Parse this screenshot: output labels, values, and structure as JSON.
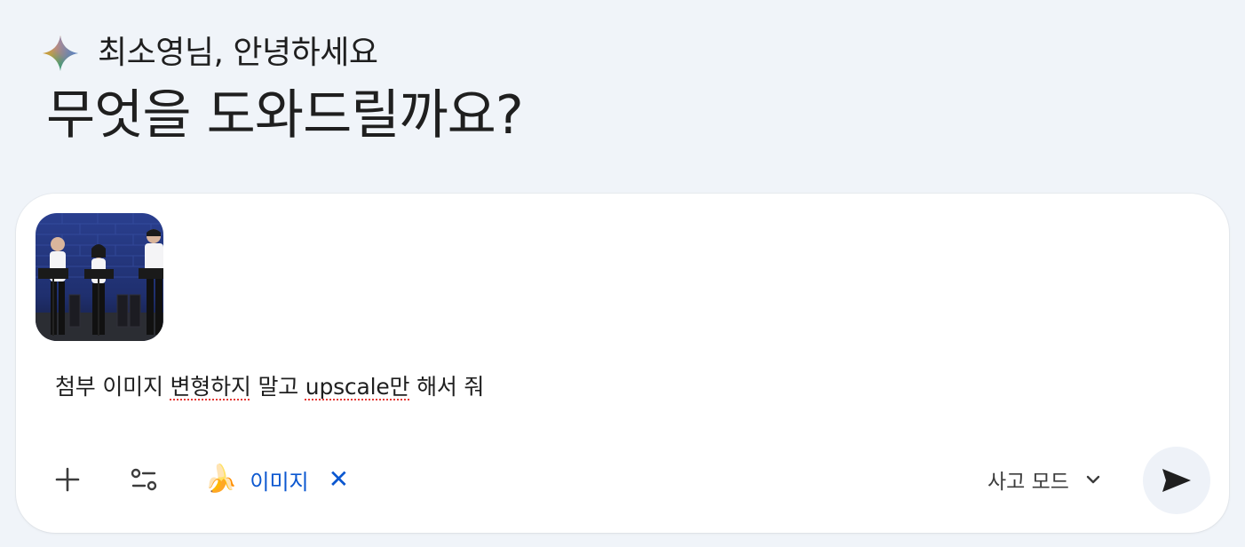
{
  "greeting": {
    "small": "최소영님, 안녕하세요",
    "headline": "무엇을 도와드릴까요?"
  },
  "prompt": {
    "attachment": "attached-image-thumbnail",
    "text_before": "첨부 이미지 ",
    "text_err1": "변형하지",
    "text_mid": " 말고 ",
    "text_err2": "upscale만",
    "text_after": " 해서 줘"
  },
  "toolbar": {
    "tool_chip_emoji": "🍌",
    "tool_chip_label": "이미지",
    "tool_chip_close": "✕",
    "mode_label": "사고 모드"
  },
  "icons": {
    "spark": "gemini-spark-icon",
    "plus": "plus-icon",
    "tools": "tools-icon",
    "chevron": "chevron-down-icon",
    "send": "send-icon"
  },
  "colors": {
    "background": "#f0f4f9",
    "accent": "#0b57d0",
    "send_bg": "#eef2f8"
  }
}
